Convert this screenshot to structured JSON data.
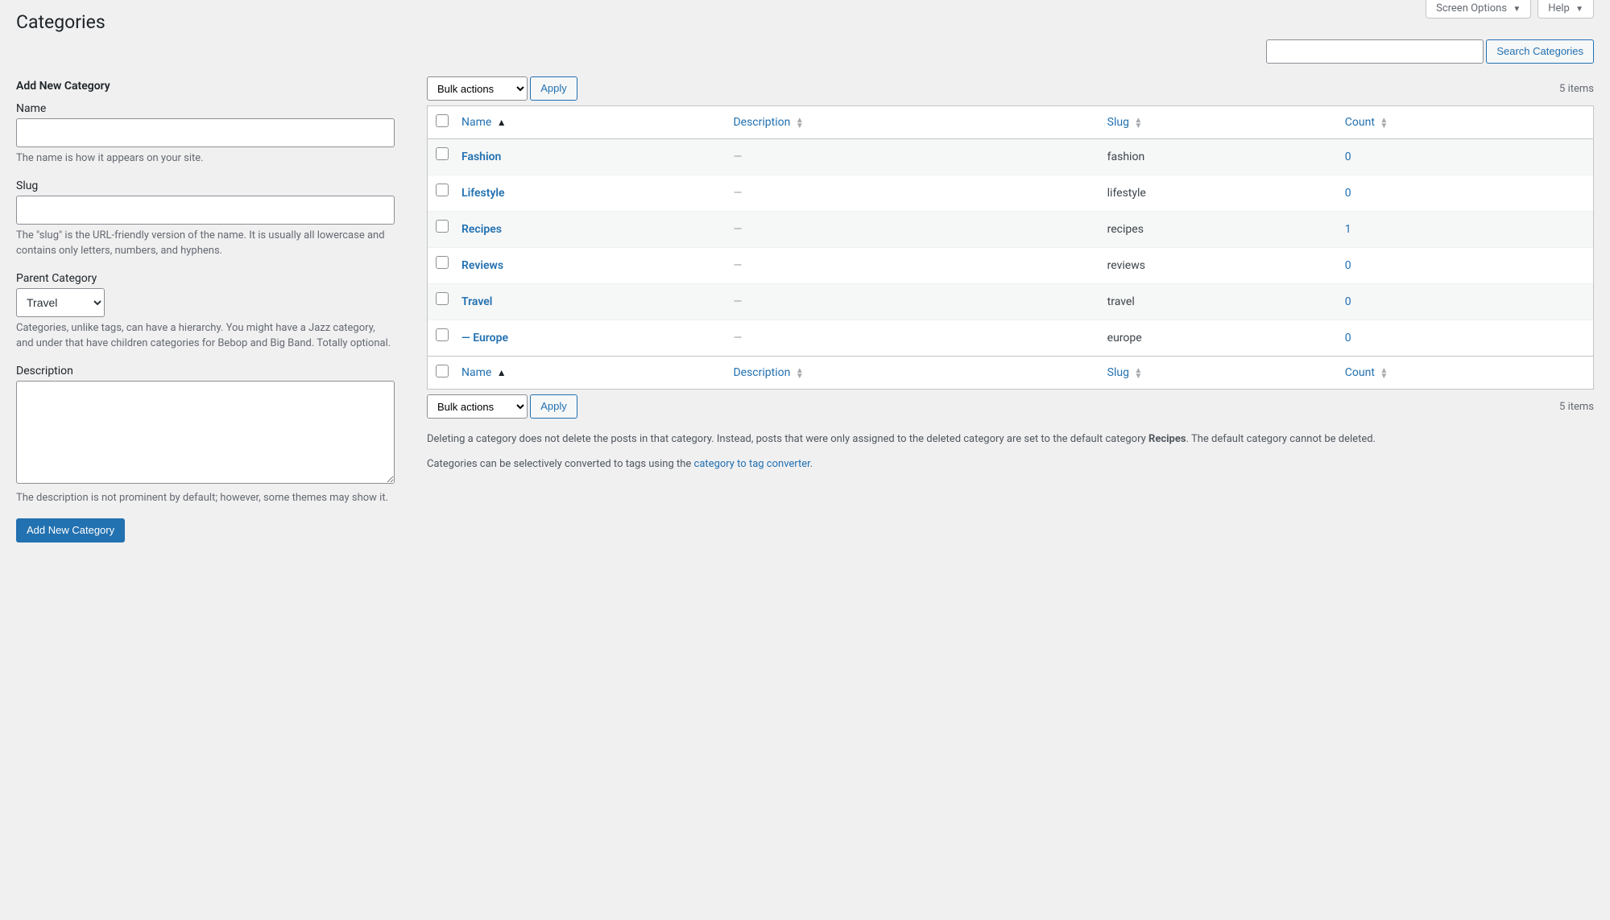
{
  "screen_tabs": {
    "options": "Screen Options",
    "help": "Help"
  },
  "page_title": "Categories",
  "search": {
    "button": "Search Categories",
    "placeholder": ""
  },
  "form": {
    "heading": "Add New Category",
    "name_label": "Name",
    "name_help": "The name is how it appears on your site.",
    "slug_label": "Slug",
    "slug_help": "The \"slug\" is the URL-friendly version of the name. It is usually all lowercase and contains only letters, numbers, and hyphens.",
    "parent_label": "Parent Category",
    "parent_selected": "Travel",
    "parent_help": "Categories, unlike tags, can have a hierarchy. You might have a Jazz category, and under that have children categories for Bebop and Big Band. Totally optional.",
    "desc_label": "Description",
    "desc_help": "The description is not prominent by default; however, some themes may show it.",
    "submit": "Add New Category"
  },
  "bulk": {
    "label": "Bulk actions",
    "apply": "Apply"
  },
  "items_count": "5 items",
  "columns": {
    "name": "Name",
    "description": "Description",
    "slug": "Slug",
    "count": "Count"
  },
  "rows": [
    {
      "name": "Fashion",
      "indent": 0,
      "desc": "—",
      "slug": "fashion",
      "count": "0"
    },
    {
      "name": "Lifestyle",
      "indent": 0,
      "desc": "—",
      "slug": "lifestyle",
      "count": "0"
    },
    {
      "name": "Recipes",
      "indent": 0,
      "desc": "—",
      "slug": "recipes",
      "count": "1"
    },
    {
      "name": "Reviews",
      "indent": 0,
      "desc": "—",
      "slug": "reviews",
      "count": "0"
    },
    {
      "name": "Travel",
      "indent": 0,
      "desc": "—",
      "slug": "travel",
      "count": "0"
    },
    {
      "name": "— Europe",
      "indent": 0,
      "desc": "—",
      "slug": "europe",
      "count": "0"
    }
  ],
  "notes": {
    "p1a": "Deleting a category does not delete the posts in that category. Instead, posts that were only assigned to the deleted category are set to the default category ",
    "p1b": "Recipes",
    "p1c": ". The default category cannot be deleted.",
    "p2a": "Categories can be selectively converted to tags using the ",
    "p2link": "category to tag converter",
    "p2b": "."
  }
}
